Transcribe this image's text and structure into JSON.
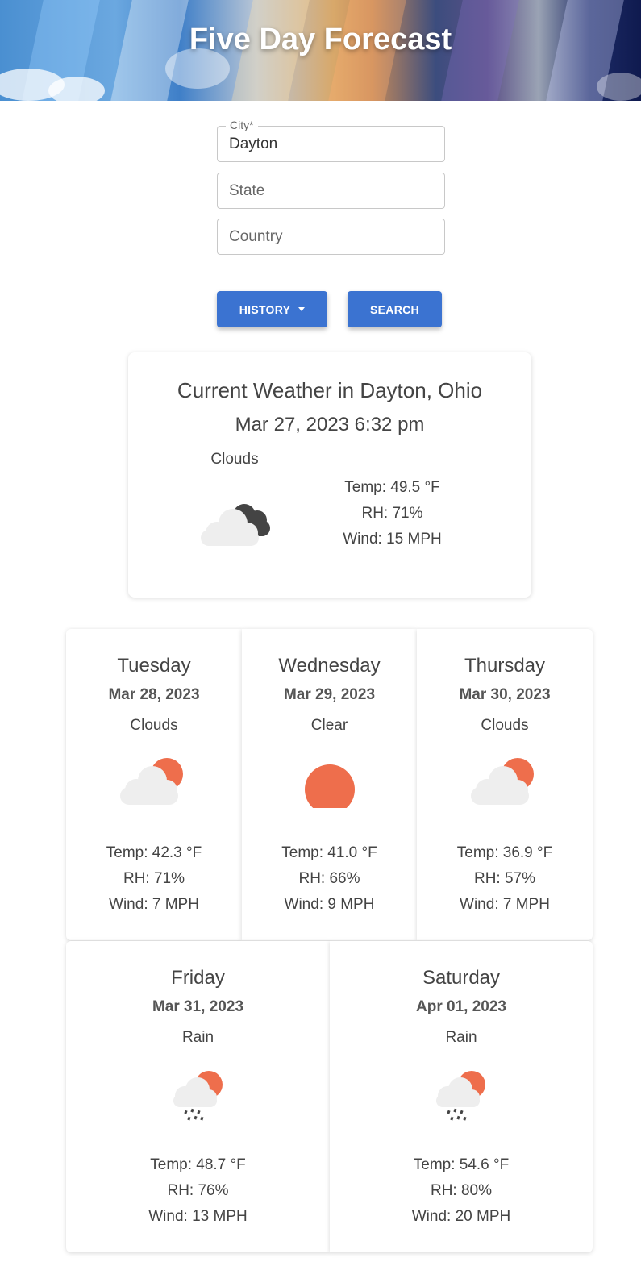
{
  "header": {
    "title": "Five Day Forecast"
  },
  "form": {
    "city_label": "City*",
    "city_value": "Dayton",
    "state_placeholder": "State",
    "country_placeholder": "Country",
    "history_label": "HISTORY",
    "search_label": "SEARCH"
  },
  "current": {
    "title": "Current Weather in Dayton, Ohio",
    "datetime": "Mar 27, 2023 6:32 pm",
    "condition": "Clouds",
    "icon": "night-cloud-icon",
    "temp": "Temp: 49.5 °F",
    "rh": "RH: 71%",
    "wind": "Wind: 15 MPH"
  },
  "forecast": [
    {
      "day": "Tuesday",
      "date": "Mar 28, 2023",
      "condition": "Clouds",
      "icon": "partly-cloudy-icon",
      "temp": "Temp: 42.3 °F",
      "rh": "RH: 71%",
      "wind": "Wind: 7 MPH"
    },
    {
      "day": "Wednesday",
      "date": "Mar 29, 2023",
      "condition": "Clear",
      "icon": "sun-icon",
      "temp": "Temp: 41.0 °F",
      "rh": "RH: 66%",
      "wind": "Wind: 9 MPH"
    },
    {
      "day": "Thursday",
      "date": "Mar 30, 2023",
      "condition": "Clouds",
      "icon": "partly-cloudy-icon",
      "temp": "Temp: 36.9 °F",
      "rh": "RH: 57%",
      "wind": "Wind: 7 MPH"
    },
    {
      "day": "Friday",
      "date": "Mar 31, 2023",
      "condition": "Rain",
      "icon": "rain-icon",
      "temp": "Temp: 48.7 °F",
      "rh": "RH: 76%",
      "wind": "Wind: 13 MPH"
    },
    {
      "day": "Saturday",
      "date": "Apr 01, 2023",
      "condition": "Rain",
      "icon": "rain-icon",
      "temp": "Temp: 54.6 °F",
      "rh": "RH: 80%",
      "wind": "Wind: 20 MPH"
    }
  ],
  "colors": {
    "accent": "#3b73d1",
    "sun": "#ee6e4c",
    "cloud": "#eeeeee",
    "dark_cloud": "#444444"
  }
}
